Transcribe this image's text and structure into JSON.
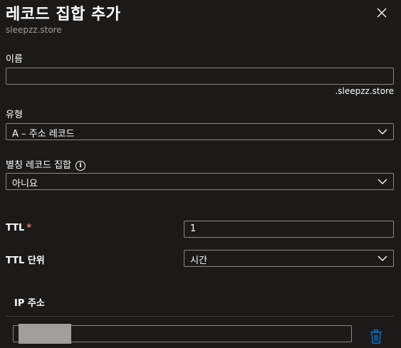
{
  "panel": {
    "title": "레코드 집합 추가",
    "subtitle": "sleepzz.store"
  },
  "fields": {
    "name": {
      "label": "이름",
      "value": "",
      "suffix": ".sleepzz.store"
    },
    "type": {
      "label": "유형",
      "value": "A – 주소 레코드"
    },
    "alias": {
      "label": "별칭 레코드 집합",
      "value": "아니요"
    },
    "ttl": {
      "label": "TTL",
      "required_mark": "*",
      "value": "1"
    },
    "ttl_unit": {
      "label": "TTL 단위",
      "value": "시간"
    }
  },
  "ip_section": {
    "header": "IP 주소",
    "entries": [
      {
        "value": ""
      }
    ]
  },
  "icons": {
    "close": "close-icon",
    "info": "info-icon",
    "chevron": "chevron-down-icon",
    "delete": "trash-icon"
  },
  "colors": {
    "background": "#1b1a19",
    "border": "#8a8886",
    "accent": "#0078d4",
    "required": "#f1707b",
    "subtle_text": "#a19f9d"
  }
}
